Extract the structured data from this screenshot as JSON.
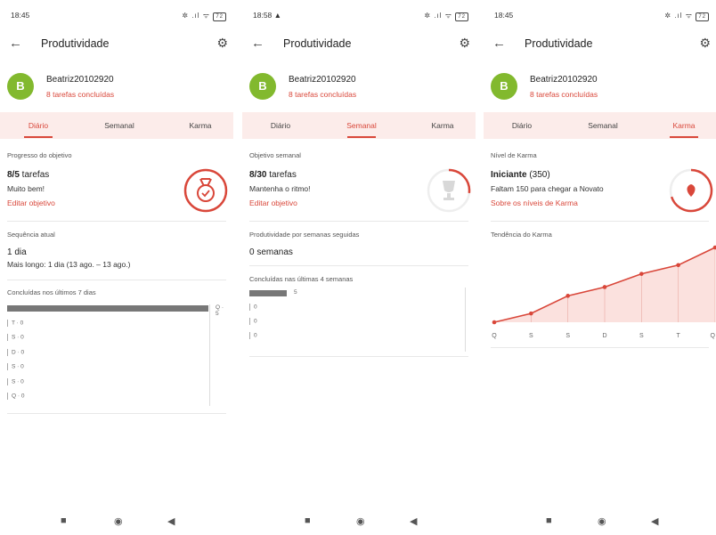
{
  "screens": [
    {
      "status": {
        "time": "18:45",
        "icons": "✲ .ıl ᯤ",
        "battery": "72"
      },
      "appbar": {
        "title": "Produtividade"
      },
      "user": {
        "initial": "B",
        "name": "Beatriz20102920",
        "done": "8 tarefas concluídas"
      },
      "tabs": [
        "Diário",
        "Semanal",
        "Karma"
      ],
      "active_tab": 0,
      "goal": {
        "label": "Progresso do objetivo",
        "count": "8/5",
        "count_suffix": " tarefas",
        "message": "Muito bem!",
        "edit": "Editar objetivo"
      },
      "streak": {
        "label": "Sequência atual",
        "value": "1 dia",
        "longest": "Mais longo: 1 dia (13 ago. – 13 ago.)"
      },
      "last7": {
        "label": "Concluídas nos últimos 7 dias",
        "rows": [
          {
            "day": "Q",
            "value": 5,
            "text": "Q · 5"
          },
          {
            "day": "T",
            "value": 0,
            "text": "T · 0"
          },
          {
            "day": "S",
            "value": 0,
            "text": "S · 0"
          },
          {
            "day": "D",
            "value": 0,
            "text": "D · 0"
          },
          {
            "day": "S",
            "value": 0,
            "text": "S · 0"
          },
          {
            "day": "S",
            "value": 0,
            "text": "S · 0"
          },
          {
            "day": "Q",
            "value": 0,
            "text": "Q · 0"
          }
        ]
      }
    },
    {
      "status": {
        "time": "18:58 ▲",
        "icons": "✲ .ıl ᯤ",
        "battery": "72"
      },
      "appbar": {
        "title": "Produtividade"
      },
      "user": {
        "initial": "B",
        "name": "Beatriz20102920",
        "done": "8 tarefas concluídas"
      },
      "tabs": [
        "Diário",
        "Semanal",
        "Karma"
      ],
      "active_tab": 1,
      "goal": {
        "label": "Objetivo semanal",
        "count": "8/30",
        "count_suffix": " tarefas",
        "message": "Mantenha o ritmo!",
        "edit": "Editar objetivo",
        "progress": 0.27
      },
      "streak": {
        "label": "Produtividade por semanas seguidas",
        "value": "0 semanas"
      },
      "last4": {
        "label": "Concluídas nas últimas 4 semanas",
        "rows": [
          {
            "value": 5,
            "text": "5"
          },
          {
            "value": 0,
            "text": "0"
          },
          {
            "value": 0,
            "text": "0"
          },
          {
            "value": 0,
            "text": "0"
          }
        ]
      }
    },
    {
      "status": {
        "time": "18:45",
        "icons": "✲ .ıl ᯤ",
        "battery": "72"
      },
      "appbar": {
        "title": "Produtividade"
      },
      "user": {
        "initial": "B",
        "name": "Beatriz20102920",
        "done": "8 tarefas concluídas"
      },
      "tabs": [
        "Diário",
        "Semanal",
        "Karma"
      ],
      "active_tab": 2,
      "karma": {
        "label": "Nível de Karma",
        "level": "Iniciante",
        "points": " (350)",
        "next": "Faltam 150 para chegar a Novato",
        "link": "Sobre os níveis de Karma",
        "progress": 0.7
      },
      "trend": {
        "label": "Tendência do Karma"
      }
    }
  ],
  "chart_data": {
    "type": "area",
    "title": "Tendência do Karma",
    "categories": [
      "Q",
      "S",
      "S",
      "D",
      "S",
      "T",
      "Q"
    ],
    "series": [
      {
        "values": [
          0,
          1,
          3,
          4,
          5.5,
          6.5,
          8.5
        ]
      }
    ],
    "color": "#d9473a"
  },
  "colors": {
    "accent": "#d9473a",
    "avatar": "#82b92e",
    "tab_bg": "#fcecea"
  }
}
